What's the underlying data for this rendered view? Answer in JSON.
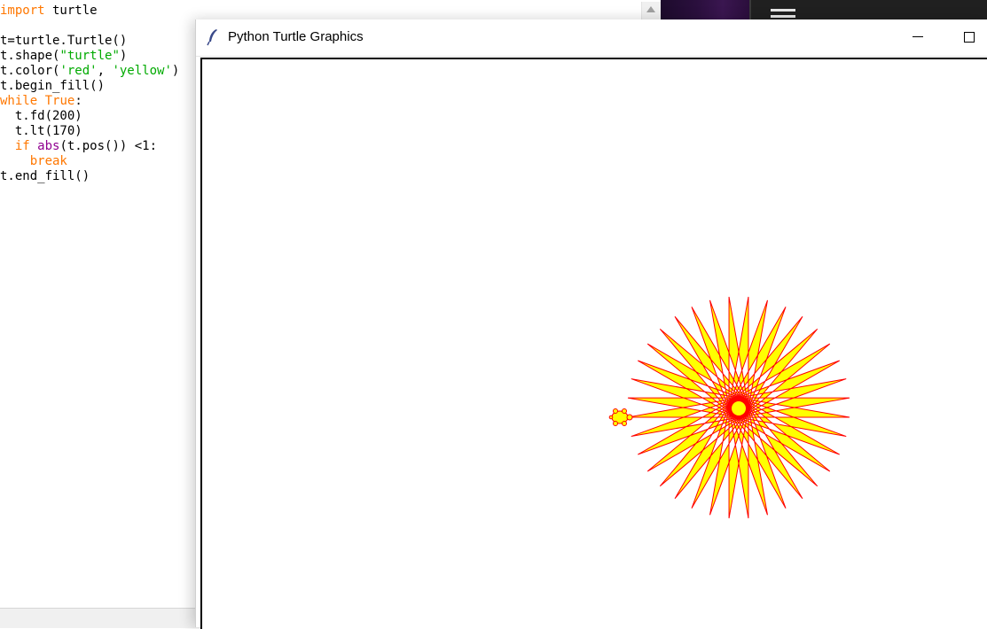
{
  "editor": {
    "code_lines": [
      [
        {
          "t": "import",
          "c": "kw"
        },
        {
          "t": " turtle",
          "c": ""
        }
      ],
      [],
      [
        {
          "t": "t=turtle.Turtle()",
          "c": ""
        }
      ],
      [
        {
          "t": "t.shape(",
          "c": ""
        },
        {
          "t": "\"turtle\"",
          "c": "st"
        },
        {
          "t": ")",
          "c": ""
        }
      ],
      [
        {
          "t": "t.color(",
          "c": ""
        },
        {
          "t": "'red'",
          "c": "st"
        },
        {
          "t": ", ",
          "c": ""
        },
        {
          "t": "'yellow'",
          "c": "st"
        },
        {
          "t": ")",
          "c": ""
        }
      ],
      [
        {
          "t": "t.begin_fill()",
          "c": ""
        }
      ],
      [
        {
          "t": "while",
          "c": "kw"
        },
        {
          "t": " ",
          "c": ""
        },
        {
          "t": "True",
          "c": "kw"
        },
        {
          "t": ":",
          "c": ""
        }
      ],
      [
        {
          "t": "  t.fd(200)",
          "c": ""
        }
      ],
      [
        {
          "t": "  t.lt(170)",
          "c": ""
        }
      ],
      [
        {
          "t": "  ",
          "c": ""
        },
        {
          "t": "if",
          "c": "kw"
        },
        {
          "t": " ",
          "c": ""
        },
        {
          "t": "abs",
          "c": "bi"
        },
        {
          "t": "(t.pos()) <1:",
          "c": ""
        }
      ],
      [
        {
          "t": "    ",
          "c": ""
        },
        {
          "t": "break",
          "c": "kw"
        }
      ],
      [
        {
          "t": "t.end_fill()",
          "c": ""
        }
      ]
    ]
  },
  "turtle_window": {
    "title": "Python Turtle Graphics"
  },
  "drawing": {
    "pen_color": "#ff0000",
    "fill_color": "#ffff00",
    "step_distance": 200,
    "turn_angle_degrees": 170,
    "star_points": 36
  }
}
